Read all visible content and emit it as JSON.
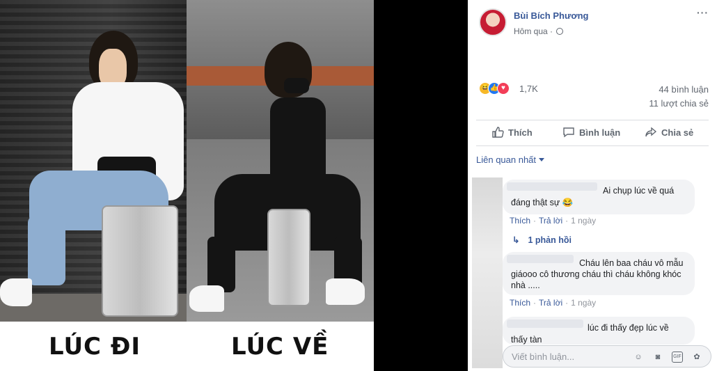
{
  "photo": {
    "left_caption": "LÚC ĐI",
    "right_caption": "LÚC VỀ"
  },
  "post": {
    "author": "Bùi Bích Phương",
    "time": "Hôm qua ·",
    "more": "···"
  },
  "stats": {
    "reactions": "1,7K",
    "comments": "44 bình luận",
    "shares": "11 lượt chia sẻ"
  },
  "actions": {
    "like": "Thích",
    "comment": "Bình luận",
    "share": "Chia sẻ"
  },
  "sort_label": "Liên quan nhất",
  "comments": [
    {
      "text": "Ai chụp lúc về quá đáng thật sự 😂",
      "like": "Thích",
      "reply": "Trả lời",
      "time": "1 ngày",
      "replies": "1 phản hồi"
    },
    {
      "text": "Cháu lên baa cháu vô mẫu giáooo cô thương cháu thì cháu không khóc nhà .....",
      "like": "Thích",
      "reply": "Trả lời",
      "time": "1 ngày"
    },
    {
      "text": "lúc đi thấy đẹp lúc về thấy tàn"
    }
  ],
  "composer": {
    "placeholder": "Viết bình luận..."
  },
  "colors": {
    "link": "#385898",
    "muted": "#616770",
    "bubble": "#f2f3f5"
  }
}
